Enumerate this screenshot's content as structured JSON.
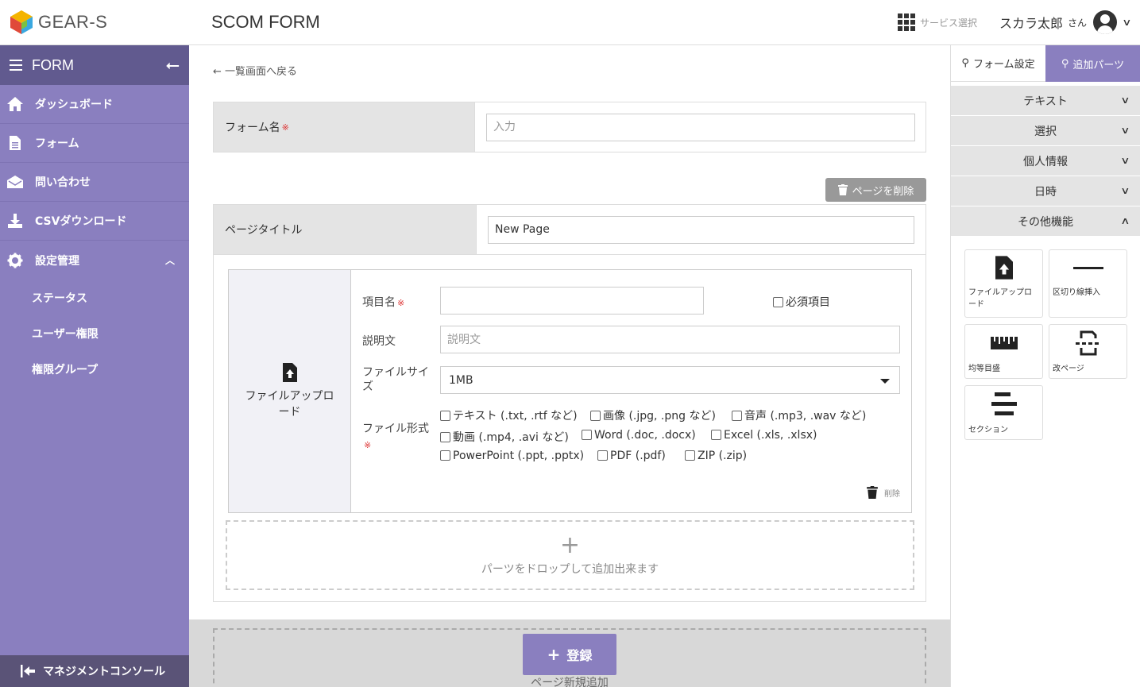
{
  "header": {
    "logo_text": "GEAR-S",
    "app_title": "SCOM FORM",
    "service_select": "サービス選択",
    "user_name": "スカラ太郎",
    "user_suffix": "さん"
  },
  "sidebar": {
    "title": "FORM",
    "items": [
      {
        "label": "ダッシュボード",
        "icon": "home-icon"
      },
      {
        "label": "フォーム",
        "icon": "document-icon"
      },
      {
        "label": "問い合わせ",
        "icon": "envelope-icon"
      },
      {
        "label": "CSVダウンロード",
        "icon": "download-icon"
      },
      {
        "label": "設定管理",
        "icon": "gear-icon"
      }
    ],
    "sub_items": [
      "ステータス",
      "ユーザー権限",
      "権限グループ"
    ],
    "footer": "マネジメントコンソール"
  },
  "main": {
    "back_link": "← 一覧画面へ戻る",
    "form_name_label": "フォーム名",
    "required_mark": "※",
    "form_name_placeholder": "入力",
    "delete_page": "ページを削除",
    "page_title_label": "ページタイトル",
    "page_title_value": "New Page",
    "part": {
      "type_label": "ファイルアップロード",
      "item_name_label": "項目名",
      "required_item_label": "必須項目",
      "description_label": "説明文",
      "description_placeholder": "説明文",
      "file_size_label": "ファイルサイズ",
      "file_size_value": "1MB",
      "file_format_label": "ファイル形式",
      "formats": [
        "テキスト (.txt, .rtf など)",
        "画像 (.jpg, .png など)",
        "音声 (.mp3, .wav など)",
        "動画 (.mp4, .avi など)",
        "Word (.doc, .docx)",
        "Excel (.xls, .xlsx)",
        "PowerPoint (.ppt, .pptx)",
        "PDF (.pdf)",
        "ZIP (.zip)"
      ],
      "delete_label": "削除"
    },
    "drop_zone_text": "パーツをドロップして追加出来ます",
    "new_page_text": "ページ新規追加",
    "submit_label": "登録"
  },
  "right_panel": {
    "tabs": [
      "フォーム設定",
      "追加パーツ"
    ],
    "accordions": [
      "テキスト",
      "選択",
      "個人情報",
      "日時",
      "その他機能"
    ],
    "tiles": [
      "ファイルアップロード",
      "区切り線挿入",
      "均等目盛",
      "改ページ",
      "セクション"
    ]
  },
  "colors": {
    "accent": "#8a7fbf",
    "sidebar_header": "#615a8f",
    "footer": "#5a5377",
    "required": "#dd3333"
  }
}
